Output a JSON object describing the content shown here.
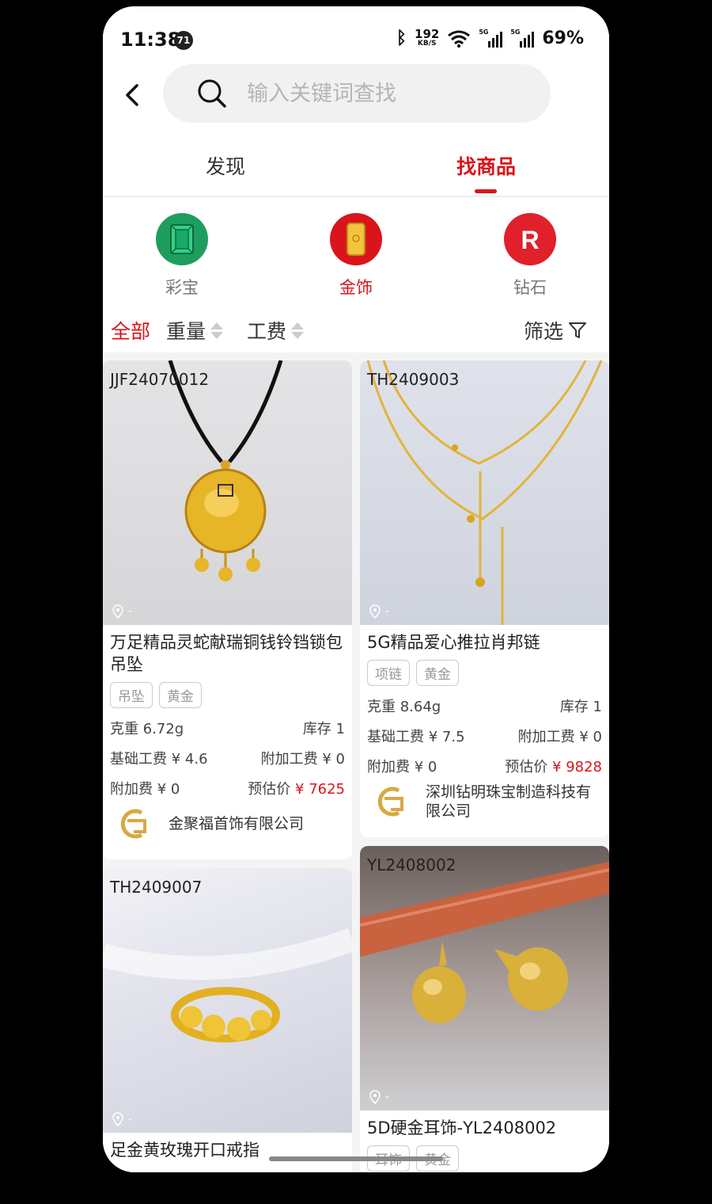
{
  "status": {
    "time": "11:38",
    "notification_count": "71",
    "net_speed_value": "192",
    "net_speed_unit": "KB/S",
    "signal1_label": "5G",
    "signal2_label": "5G",
    "battery": "69%"
  },
  "search": {
    "placeholder": "输入关键词查找"
  },
  "tabs": [
    {
      "label": "发现",
      "active": false
    },
    {
      "label": "找商品",
      "active": true
    }
  ],
  "categories": [
    {
      "label": "彩宝",
      "icon": "emerald-gem-icon",
      "color": "#1e9e5e",
      "active": false
    },
    {
      "label": "金饰",
      "icon": "gold-bar-icon",
      "color": "#d9151b",
      "active": true
    },
    {
      "label": "钻石",
      "icon": "r-logo-icon",
      "color": "#e0202a",
      "active": false
    }
  ],
  "sort": {
    "all": "全部",
    "weight": "重量",
    "labor": "工费",
    "filter": "筛选"
  },
  "products": [
    {
      "code": "JJF24070012",
      "location": "-",
      "title": "万足精品灵蛇献瑞铜钱铃铛锁包吊坠",
      "tags": [
        "吊坠",
        "黄金"
      ],
      "weight": "克重 6.72g",
      "stock": "库存 1",
      "base_fee": "基础工费 ¥ 4.6",
      "extra_labor": "附加工费 ¥ 0",
      "extra_fee": "附加费 ¥ 0",
      "est_label": "预估价",
      "est_price": "¥ 7625",
      "shop": "金聚福首饰有限公司"
    },
    {
      "code": "TH2409003",
      "location": "-",
      "title": "5G精品爱心推拉肖邦链",
      "tags": [
        "项链",
        "黄金"
      ],
      "weight": "克重 8.64g",
      "stock": "库存 1",
      "base_fee": "基础工费 ¥ 7.5",
      "extra_labor": "附加工费 ¥ 0",
      "extra_fee": "附加费 ¥ 0",
      "est_label": "预估价",
      "est_price": "¥ 9828",
      "shop": "深圳钻明珠宝制造科技有限公司"
    },
    {
      "code": "TH2409007",
      "location": "-",
      "title": "足金黄玫瑰开口戒指",
      "tags": []
    },
    {
      "code": "YL2408002",
      "location": "-",
      "title": "5D硬金耳饰-YL2408002",
      "tags": [
        "耳饰",
        "黄金"
      ]
    }
  ],
  "colors": {
    "accent": "#d9151b",
    "gold": "#e3b73a"
  }
}
